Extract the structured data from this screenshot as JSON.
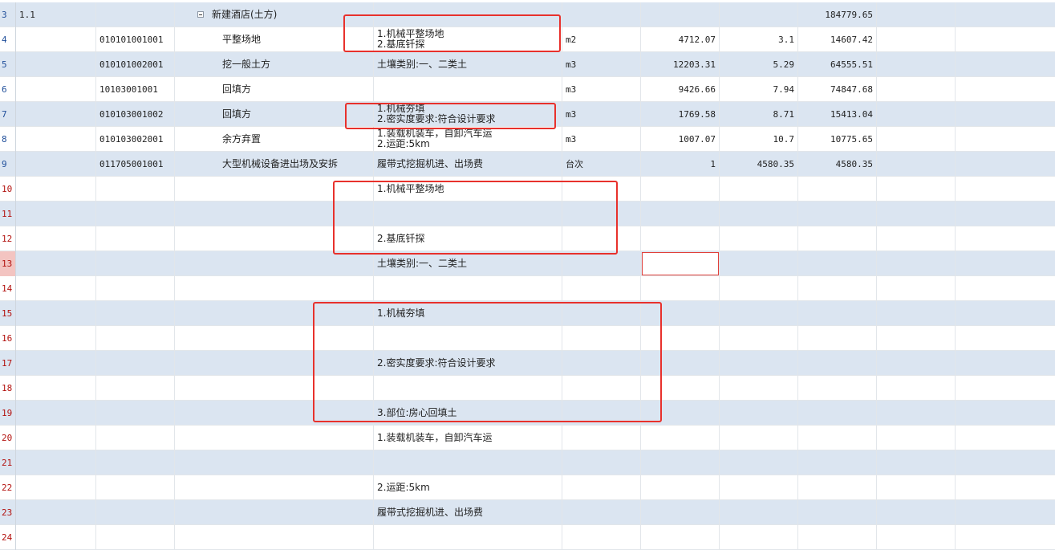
{
  "colors": {
    "row_alt": "#dbe5f1",
    "row_white": "#ffffff",
    "highlight_red": "#e8312c",
    "row_number_blue": "#1f4e9a",
    "row_number_red": "#b3120f"
  },
  "icons": {
    "collapse": "collapse-minus-icon"
  },
  "rows": [
    {
      "row_num": "3",
      "index": "1.1",
      "code": "",
      "name": "新建酒店(土方)",
      "features": [],
      "unit": "",
      "quantity": "",
      "unit_price": "",
      "total": "184779.65"
    },
    {
      "row_num": "4",
      "index": "",
      "code": "010101001001",
      "name": "平整场地",
      "features": [
        "1.机械平整场地",
        "2.基底钎探"
      ],
      "unit": "m2",
      "quantity": "4712.07",
      "unit_price": "3.1",
      "total": "14607.42"
    },
    {
      "row_num": "5",
      "index": "",
      "code": "010101002001",
      "name": "挖一般土方",
      "features": [
        "土壤类别:一、二类土"
      ],
      "unit": "m3",
      "quantity": "12203.31",
      "unit_price": "5.29",
      "total": "64555.51"
    },
    {
      "row_num": "6",
      "index": "",
      "code": "10103001001",
      "name": "回填方",
      "features": [],
      "unit": "m3",
      "quantity": "9426.66",
      "unit_price": "7.94",
      "total": "74847.68"
    },
    {
      "row_num": "7",
      "index": "",
      "code": "010103001002",
      "name": "回填方",
      "features": [
        "1.机械夯填",
        "2.密实度要求:符合设计要求"
      ],
      "unit": "m3",
      "quantity": "1769.58",
      "unit_price": "8.71",
      "total": "15413.04"
    },
    {
      "row_num": "8",
      "index": "",
      "code": "010103002001",
      "name": "余方弃置",
      "features": [
        "1.装载机装车，自卸汽车运",
        "2.运距:5km"
      ],
      "unit": "m3",
      "quantity": "1007.07",
      "unit_price": "10.7",
      "total": "10775.65"
    },
    {
      "row_num": "9",
      "index": "",
      "code": "011705001001",
      "name": "大型机械设备进出场及安拆",
      "features": [
        "履带式挖掘机进、出场费"
      ],
      "unit": "台次",
      "quantity": "1",
      "unit_price": "4580.35",
      "total": "4580.35"
    },
    {
      "row_num": "10",
      "features": [
        "1.机械平整场地"
      ]
    },
    {
      "row_num": "11",
      "features": []
    },
    {
      "row_num": "12",
      "features": [
        "2.基底钎探"
      ]
    },
    {
      "row_num": "13",
      "features": [
        "土壤类别:一、二类土"
      ]
    },
    {
      "row_num": "14",
      "features": []
    },
    {
      "row_num": "15",
      "features": [
        "1.机械夯填"
      ]
    },
    {
      "row_num": "16",
      "features": []
    },
    {
      "row_num": "17",
      "features": [
        "2.密实度要求:符合设计要求"
      ]
    },
    {
      "row_num": "18",
      "features": []
    },
    {
      "row_num": "19",
      "features": [
        "3.部位:房心回填土"
      ]
    },
    {
      "row_num": "20",
      "features": [
        "1.装载机装车，自卸汽车运"
      ]
    },
    {
      "row_num": "21",
      "features": []
    },
    {
      "row_num": "22",
      "features": [
        "2.运距:5km"
      ]
    },
    {
      "row_num": "23",
      "features": [
        "履带式挖掘机进、出场费"
      ]
    },
    {
      "row_num": "24",
      "features": []
    }
  ]
}
